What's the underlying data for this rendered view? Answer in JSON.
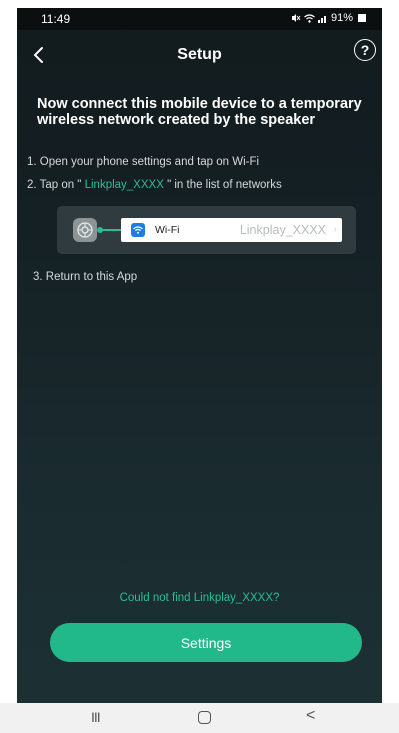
{
  "status_bar": {
    "time": "11:49",
    "signal": "⛓≈",
    "battery": "91%"
  },
  "header": {
    "back_icon": "chevron-left-icon",
    "title": "Setup",
    "help_icon": "question-circle-icon",
    "help_label": "?"
  },
  "main": {
    "heading": "Now connect this mobile device to a temporary wireless network created by the speaker",
    "step1": "1. Open your phone settings and tap on Wi-Fi",
    "step2_prefix": "2. Tap on \" ",
    "step2_network": "Linkplay_XXXX",
    "step2_suffix": " \" in the list of networks",
    "wifi_card": {
      "settings_icon": "gear-icon",
      "wifi_label": "Wi-Fi",
      "network": "Linkplay_XXXX",
      "chevron": "›"
    },
    "step3": "3. Return to this App"
  },
  "footer": {
    "could_not_find": "Could not find Linkplay_XXXX?",
    "settings_button": "Settings"
  },
  "system_nav": {
    "recent": "III",
    "back": "<"
  },
  "colors": {
    "accent": "#22b98a",
    "highlight": "#2dbd94",
    "background": "#152125"
  }
}
